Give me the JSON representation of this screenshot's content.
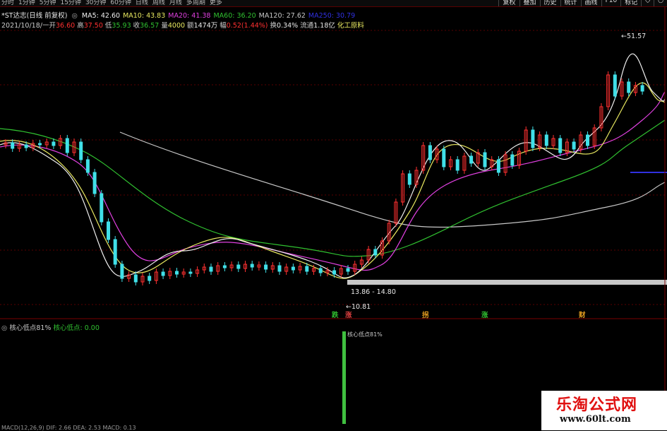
{
  "toolbar": {
    "periods": [
      "分时",
      "1分钟",
      "5分钟",
      "15分钟",
      "30分钟",
      "60分钟",
      "日线",
      "周线",
      "月线",
      "多周期",
      "更多"
    ],
    "right_buttons": [
      "复权",
      "叠加",
      "历史",
      "统计",
      "画线",
      "F10",
      "标记"
    ],
    "icons": [
      "diamond-icon",
      "circle-icon"
    ]
  },
  "header": {
    "stock_name": "*ST达志(日线 前复权)",
    "ma": [
      {
        "label": "MA5: 42.60",
        "color": "#f0f0f0"
      },
      {
        "label": "MA10: 43.83",
        "color": "#e8e860"
      },
      {
        "label": "MA20: 41.38",
        "color": "#e040e0"
      },
      {
        "label": "MA60: 36.20",
        "color": "#30c030"
      },
      {
        "label": "MA120: 27.62",
        "color": "#c8c8c8"
      },
      {
        "label": "MA250: 30.79",
        "color": "#3030e0"
      }
    ],
    "bar_info": {
      "date": "2021/10/18/一",
      "open_label": "开",
      "open": "36.60",
      "high_label": "高",
      "high": "37.50",
      "low_label": "低",
      "low": "35.93",
      "close_label": "收",
      "close": "36.57",
      "vol_label": "量",
      "vol": "4000",
      "amt_label": "额",
      "amt": "1474万",
      "chg_label": "幅",
      "chg": "0.52(1.44%)",
      "turn_label": "换",
      "turn": "0.34%",
      "float_label": "流通",
      "float": "1.18亿",
      "industry": "化工原料"
    }
  },
  "price_labels": {
    "high": "51.57",
    "range": "13.86 - 14.80",
    "low": "10.81"
  },
  "signals": [
    {
      "text": "跌",
      "color": "#30c030"
    },
    {
      "text": "涨",
      "color": "#e04040"
    },
    {
      "text": "拐",
      "color": "#e8a020"
    },
    {
      "text": "涨",
      "color": "#30c030"
    },
    {
      "text": "财",
      "color": "#e8a020"
    }
  ],
  "indicator": {
    "name": "核心低点81%",
    "line": "核心低点: 0.00",
    "bar_label": "核心低点81%",
    "bar_value": 1,
    "colors": {
      "name": "#c8c8c8",
      "line": "#30c030"
    }
  },
  "macd_label": "MACD(12,26,9) DIF: 2.66 DEA: 2.53 MACD: 0.13",
  "watermark": {
    "title": "乐淘公式网",
    "url": "www.60lt.com"
  },
  "colors": {
    "up": "#ff3030",
    "down": "#40e0e8",
    "grid": "#5a0000",
    "volume_bar": "#40c040"
  }
}
